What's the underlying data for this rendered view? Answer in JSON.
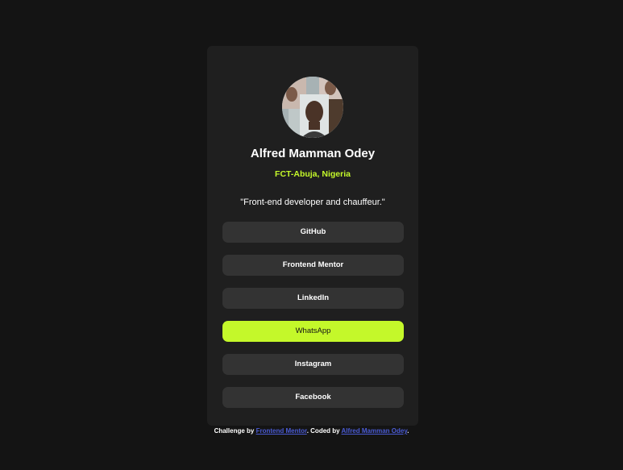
{
  "profile": {
    "avatar_icon": "profile-photo",
    "name": "Alfred Mamman Odey",
    "location": "FCT-Abuja, Nigeria",
    "bio": "\"Front-end developer and chauffeur.\""
  },
  "links": [
    {
      "label": "GitHub",
      "active": false
    },
    {
      "label": "Frontend Mentor",
      "active": false
    },
    {
      "label": "LinkedIn",
      "active": false
    },
    {
      "label": "WhatsApp",
      "active": true
    },
    {
      "label": "Instagram",
      "active": false
    },
    {
      "label": "Facebook",
      "active": false
    }
  ],
  "footer": {
    "prefix": "Challenge by",
    "challenge_link": "Frontend Mentor",
    "middle": ". Coded by",
    "author_link": "Alfred Mamman Odey",
    "suffix": "."
  },
  "colors": {
    "background": "#141414",
    "card": "#1f1f1f",
    "button": "#333333",
    "accent": "#c4f82a",
    "link": "#4a5bd4"
  }
}
